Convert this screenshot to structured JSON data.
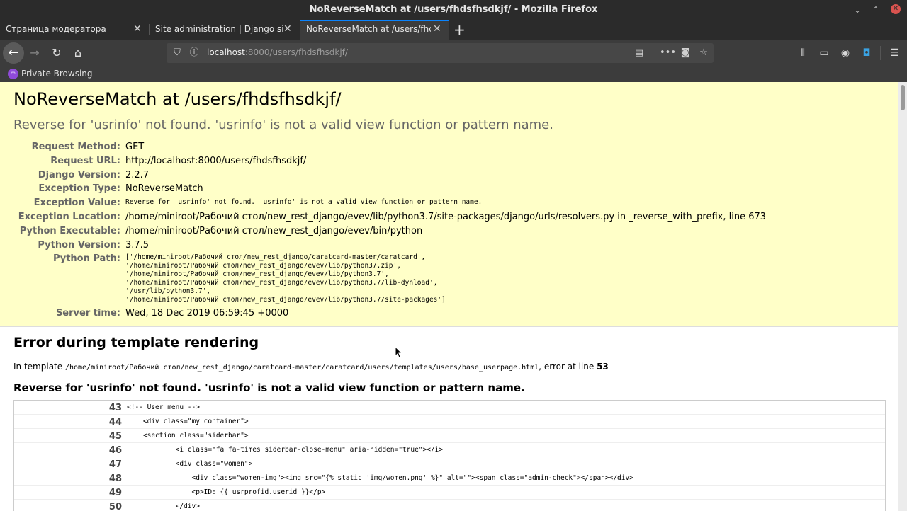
{
  "window": {
    "title": "NoReverseMatch at /users/fhdsfhsdkjf/ - Mozilla Firefox",
    "controls": [
      "minimize-icon",
      "maximize-icon",
      "close-icon"
    ]
  },
  "tabs": [
    {
      "label": "Страница модератора"
    },
    {
      "label": "Site administration | Django site"
    },
    {
      "label": "NoReverseMatch at /users/fhdsfh"
    }
  ],
  "tab_close_glyph": "✕",
  "new_tab_glyph": "+",
  "address": {
    "host": "localhost",
    "rest": ":8000/users/fhdsfhsdkjf/"
  },
  "private_browsing": "Private Browsing",
  "page": {
    "title": "NoReverseMatch at /users/fhdsfhsdkjf/",
    "subtitle": "Reverse for 'usrinfo' not found. 'usrinfo' is not a valid view function or pattern name.",
    "meta": [
      {
        "key": "Request Method:",
        "value": "GET"
      },
      {
        "key": "Request URL:",
        "value": "http://localhost:8000/users/fhdsfhsdkjf/"
      },
      {
        "key": "Django Version:",
        "value": "2.2.7"
      },
      {
        "key": "Exception Type:",
        "value": "NoReverseMatch"
      },
      {
        "key": "Exception Value:",
        "value": "Reverse for 'usrinfo' not found. 'usrinfo' is not a valid view function or pattern name."
      },
      {
        "key": "Exception Location:",
        "value": "/home/miniroot/Рабочий стол/new_rest_django/evev/lib/python3.7/site-packages/django/urls/resolvers.py in _reverse_with_prefix, line 673"
      },
      {
        "key": "Python Executable:",
        "value": "/home/miniroot/Рабочий стол/new_rest_django/evev/bin/python"
      },
      {
        "key": "Python Version:",
        "value": "3.7.5"
      },
      {
        "key": "Python Path:",
        "value_lines": [
          "['/home/miniroot/Рабочий стол/new_rest_django/caratcard-master/caratcard',",
          " '/home/miniroot/Рабочий стол/new_rest_django/evev/lib/python37.zip',",
          " '/home/miniroot/Рабочий стол/new_rest_django/evev/lib/python3.7',",
          " '/home/miniroot/Рабочий стол/new_rest_django/evev/lib/python3.7/lib-dynload',",
          " '/usr/lib/python3.7',",
          " '/home/miniroot/Рабочий стол/new_rest_django/evev/lib/python3.7/site-packages']"
        ]
      },
      {
        "key": "Server time:",
        "value": "Wed, 18 Dec 2019 06:59:45 +0000"
      }
    ],
    "template_section": {
      "heading": "Error during template rendering",
      "in_template": "In template ",
      "template_path": "/home/miniroot/Рабочий стол/new_rest_django/caratcard-master/caratcard/users/templates/users/base_userpage.html",
      "error_at": ", error at line ",
      "error_line": "53",
      "error_message": "Reverse for 'usrinfo' not found. 'usrinfo' is not a valid view function or pattern name.",
      "code": [
        {
          "num": "43",
          "src": "<!-- User menu -->"
        },
        {
          "num": "44",
          "src": "    <div class=\"my_container\">"
        },
        {
          "num": "45",
          "src": "    <section class=\"siderbar\">"
        },
        {
          "num": "46",
          "src": "            <i class=\"fa fa-times siderbar-close-menu\" aria-hidden=\"true\"></i>"
        },
        {
          "num": "47",
          "src": "            <div class=\"women\">"
        },
        {
          "num": "48",
          "src": "                <div class=\"women-img\"><img src=\"{% static 'img/women.png' %}\" alt=\"\"><span class=\"admin-check\"></span></div>"
        },
        {
          "num": "49",
          "src": "                <p>ID: {{ usrprofid.userid }}</p>"
        },
        {
          "num": "50",
          "src": "            </div>"
        }
      ]
    }
  }
}
